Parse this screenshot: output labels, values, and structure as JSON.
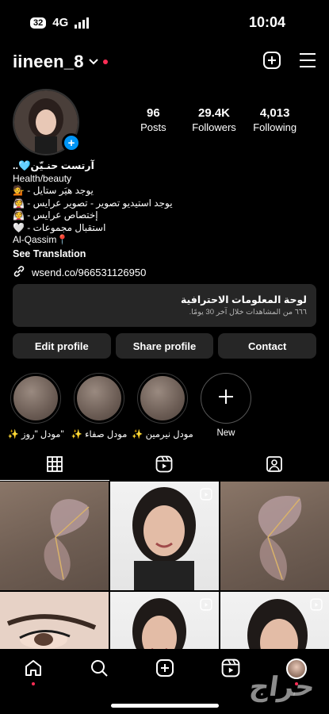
{
  "status_bar": {
    "battery": "32",
    "network": "4G",
    "time": "10:04"
  },
  "header": {
    "username": "iineen_8"
  },
  "profile": {
    "stats": [
      {
        "value": "96",
        "label": "Posts"
      },
      {
        "value": "29.4K",
        "label": "Followers"
      },
      {
        "value": "4,013",
        "label": "Following"
      }
    ],
    "name": "..🩵آرتست حنـيّن",
    "category": "Health/beauty",
    "bio_lines": [
      "💁 - يوجد هيَر ستايل",
      "👰 - يوجد استيديو تصوير - تصوير عرايس",
      "👰 - إختصاص عرايس",
      "🤍 - استقبال مجموعات"
    ],
    "location": "Al-Qassim📍",
    "see_translation": "See Translation",
    "link": "wsend.co/966531126950"
  },
  "dashboard": {
    "title": "لوحة المعلومات الاحترافية",
    "subtitle": "٦٦٦ من المشاهدات خلال آخر 30 يومًا."
  },
  "buttons": {
    "edit": "Edit profile",
    "share": "Share profile",
    "contact": "Contact"
  },
  "highlights": [
    {
      "label": "✨ مودل \"روز\""
    },
    {
      "label": "✨ مودل صفاء"
    },
    {
      "label": "✨ مودل نيرمين"
    },
    {
      "label": "New"
    }
  ],
  "watermark": "حراج",
  "colors": {
    "accent": "#0095f6",
    "notification": "#ff2d55",
    "surface": "#262626"
  }
}
